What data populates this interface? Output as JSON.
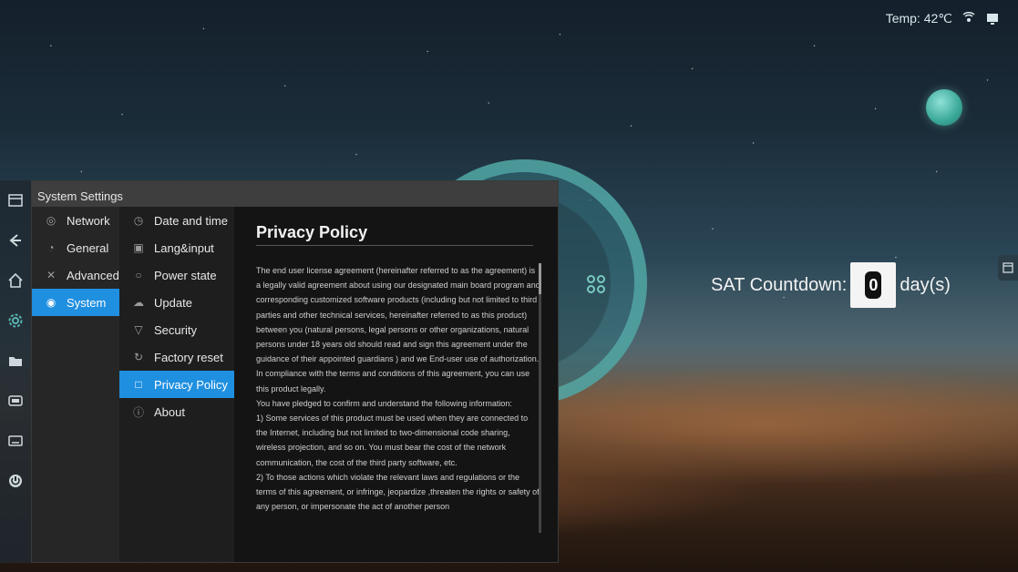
{
  "status_bar": {
    "temp": "Temp: 42℃",
    "icons": [
      "wireless-icon",
      "monitor-icon"
    ]
  },
  "countdown": {
    "label": "SAT Countdown:",
    "value": "0",
    "unit": "day(s)"
  },
  "dock": {
    "icons": [
      "window-icon",
      "back-icon",
      "home-icon",
      "settings-icon",
      "folder-icon",
      "input-source-icon",
      "keyboard-icon",
      "power-icon"
    ]
  },
  "settings": {
    "title": "System Settings",
    "categories": [
      {
        "label": "Network",
        "icon": "globe-icon"
      },
      {
        "label": "General",
        "icon": "palette-icon"
      },
      {
        "label": "Advanced",
        "icon": "tools-icon"
      },
      {
        "label": "System",
        "icon": "gear-icon",
        "active": true
      }
    ],
    "sub_items": [
      {
        "label": "Date and time",
        "icon": "clock-icon"
      },
      {
        "label": "Lang&input",
        "icon": "language-icon"
      },
      {
        "label": "Power state",
        "icon": "power-icon"
      },
      {
        "label": "Update",
        "icon": "cloud-icon"
      },
      {
        "label": "Security",
        "icon": "shield-icon"
      },
      {
        "label": "Factory reset",
        "icon": "reset-icon"
      },
      {
        "label": "Privacy Policy",
        "icon": "lock-icon",
        "active": true
      },
      {
        "label": "About",
        "icon": "info-icon"
      }
    ],
    "content": {
      "title": "Privacy Policy",
      "body": "The end user license agreement (hereinafter referred to as the agreement) is a legally valid agreement about using our designated main board program and corresponding customized software products (including but not limited to third parties and other technical services, hereinafter referred to as this product) between you (natural persons, legal persons or other organizations, natural persons under 18 years old should read and sign this agreement under the guidance of their appointed guardians ) and we End-user use of authorization.\nIn compliance with the terms and conditions of this agreement, you can use this product legally.\nYou have pledged to confirm and understand the following information:\n1)  Some services of this product must be used when they are connected to the Internet, including but not limited to two-dimensional code sharing, wireless projection, and so on. You must bear the cost of the network communication, the cost of the third party software, etc.\n2)  To those actions which violate the relevant laws and regulations or the terms of this agreement, or infringe, jeopardize ,threaten the rights or safety of any person, or impersonate the act of another person"
    }
  },
  "colors": {
    "accent": "#1f8fe0",
    "teal": "#58b4af"
  }
}
